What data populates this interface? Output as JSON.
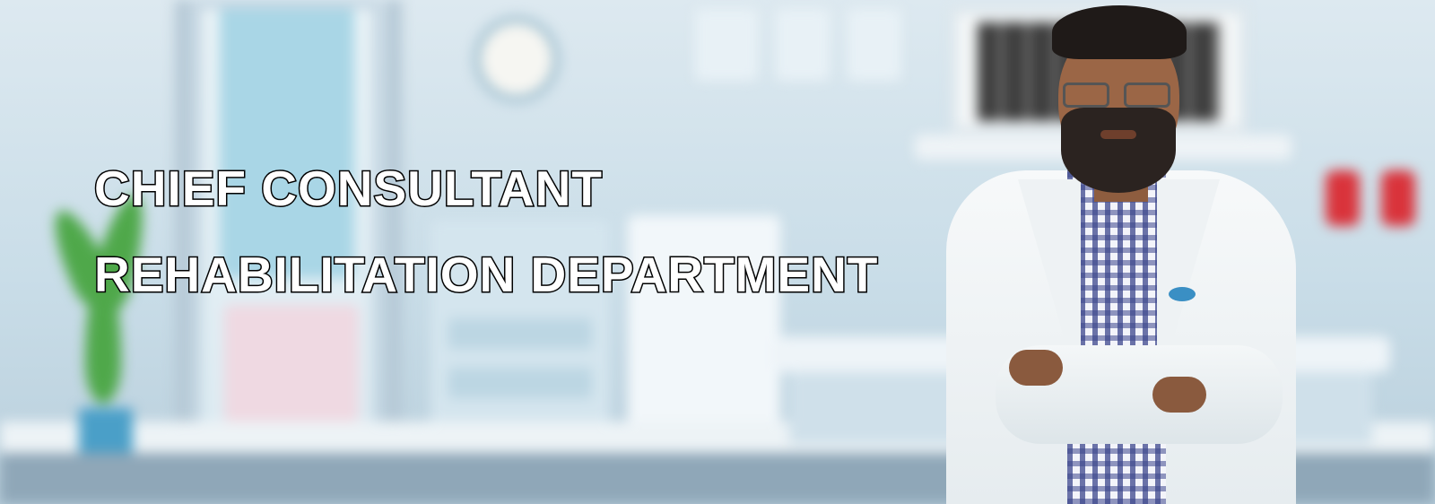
{
  "banner": {
    "headline_line1": "CHIEF CONSULTANT",
    "headline_line2": "REHABILITATION DEPARTMENT"
  },
  "colors": {
    "text_fill": "#ffffff",
    "text_outline": "#000000",
    "background": "#c9dde8"
  },
  "icons": [
    "clinic-logo-icon"
  ]
}
